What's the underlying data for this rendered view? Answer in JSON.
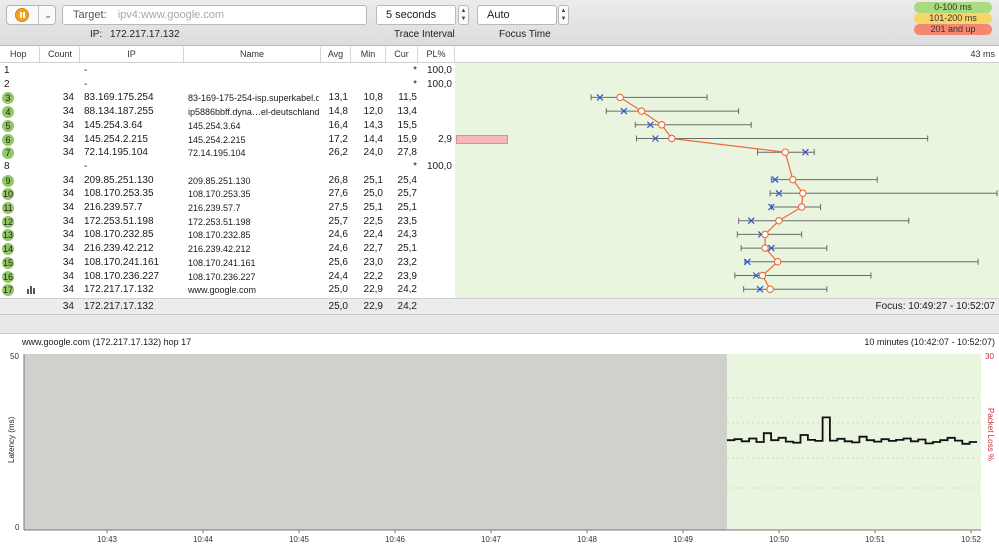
{
  "toolbar": {
    "menu_arrow": "⌄",
    "target_label": "Target:",
    "target_placeholder": "ipv4:www.google.com",
    "ip_label": "IP:",
    "ip_value": "172.217.17.132",
    "interval_value": "5 seconds",
    "interval_label": "Trace Interval",
    "focus_value": "Auto",
    "focus_label": "Focus Time",
    "legend": [
      {
        "label": "0-100 ms",
        "color": "#a9db7e"
      },
      {
        "label": "101-200 ms",
        "color": "#f6d56a"
      },
      {
        "label": "201 and up",
        "color": "#f48772"
      }
    ]
  },
  "table": {
    "headers": {
      "hop": "Hop",
      "count": "Count",
      "ip": "IP",
      "name": "Name",
      "avg": "Avg",
      "min": "Min",
      "cur": "Cur",
      "pl": "PL%"
    },
    "scale_label": "43 ms",
    "rows": [
      {
        "hop": "1",
        "count": "",
        "ip": "-",
        "name": "",
        "avg": "",
        "min": "",
        "cur": "*",
        "pl": "100,0",
        "badge": false
      },
      {
        "hop": "2",
        "count": "",
        "ip": "-",
        "name": "",
        "avg": "",
        "min": "",
        "cur": "*",
        "pl": "100,0",
        "badge": false
      },
      {
        "hop": "3",
        "count": "34",
        "ip": "83.169.175.254",
        "name": "83-169-175-254-isp.superkabel.de",
        "avg": "13,1",
        "min": "10,8",
        "cur": "11,5",
        "pl": "",
        "badge": true
      },
      {
        "hop": "4",
        "count": "34",
        "ip": "88.134.187.255",
        "name": "ip5886bbff.dyna…el-deutschland.de",
        "avg": "14,8",
        "min": "12,0",
        "cur": "13,4",
        "pl": "",
        "badge": true
      },
      {
        "hop": "5",
        "count": "34",
        "ip": "145.254.3.64",
        "name": "145.254.3.64",
        "avg": "16,4",
        "min": "14,3",
        "cur": "15,5",
        "pl": "",
        "badge": true
      },
      {
        "hop": "6",
        "count": "34",
        "ip": "145.254.2.215",
        "name": "145.254.2.215",
        "avg": "17,2",
        "min": "14,4",
        "cur": "15,9",
        "pl": "2,9",
        "badge": true
      },
      {
        "hop": "7",
        "count": "34",
        "ip": "72.14.195.104",
        "name": "72.14.195.104",
        "avg": "26,2",
        "min": "24,0",
        "cur": "27,8",
        "pl": "",
        "badge": true
      },
      {
        "hop": "8",
        "count": "",
        "ip": "-",
        "name": "",
        "avg": "",
        "min": "",
        "cur": "*",
        "pl": "100,0",
        "badge": false
      },
      {
        "hop": "9",
        "count": "34",
        "ip": "209.85.251.130",
        "name": "209.85.251.130",
        "avg": "26,8",
        "min": "25,1",
        "cur": "25,4",
        "pl": "",
        "badge": true
      },
      {
        "hop": "10",
        "count": "34",
        "ip": "108.170.253.35",
        "name": "108.170.253.35",
        "avg": "27,6",
        "min": "25,0",
        "cur": "25,7",
        "pl": "",
        "badge": true
      },
      {
        "hop": "11",
        "count": "34",
        "ip": "216.239.57.7",
        "name": "216.239.57.7",
        "avg": "27,5",
        "min": "25,1",
        "cur": "25,1",
        "pl": "",
        "badge": true
      },
      {
        "hop": "12",
        "count": "34",
        "ip": "172.253.51.198",
        "name": "172.253.51.198",
        "avg": "25,7",
        "min": "22,5",
        "cur": "23,5",
        "pl": "",
        "badge": true
      },
      {
        "hop": "13",
        "count": "34",
        "ip": "108.170.232.85",
        "name": "108.170.232.85",
        "avg": "24,6",
        "min": "22,4",
        "cur": "24,3",
        "pl": "",
        "badge": true
      },
      {
        "hop": "14",
        "count": "34",
        "ip": "216.239.42.212",
        "name": "216.239.42.212",
        "avg": "24,6",
        "min": "22,7",
        "cur": "25,1",
        "pl": "",
        "badge": true
      },
      {
        "hop": "15",
        "count": "34",
        "ip": "108.170.241.161",
        "name": "108.170.241.161",
        "avg": "25,6",
        "min": "23,0",
        "cur": "23,2",
        "pl": "",
        "badge": true
      },
      {
        "hop": "16",
        "count": "34",
        "ip": "108.170.236.227",
        "name": "108.170.236.227",
        "avg": "24,4",
        "min": "22,2",
        "cur": "23,9",
        "pl": "",
        "badge": true
      },
      {
        "hop": "17",
        "count": "34",
        "ip": "172.217.17.132",
        "name": "www.google.com",
        "avg": "25,0",
        "min": "22,9",
        "cur": "24,2",
        "pl": "",
        "badge": true
      }
    ],
    "summary": {
      "count": "34",
      "ip": "172.217.17.132",
      "avg": "25,0",
      "min": "22,9",
      "cur": "24,2"
    },
    "focus_text": "Focus: 10:49:27 - 10:52:07"
  },
  "chart_data": [
    {
      "type": "scatter",
      "x_unit": "ms",
      "x_max": 43,
      "hops": [
        3,
        4,
        5,
        6,
        7,
        9,
        10,
        11,
        12,
        13,
        14,
        15,
        16,
        17
      ],
      "avg": [
        13.1,
        14.8,
        16.4,
        17.2,
        26.2,
        26.8,
        27.6,
        27.5,
        25.7,
        24.6,
        24.6,
        25.6,
        24.4,
        25.0
      ],
      "min": [
        10.8,
        12.0,
        14.3,
        14.4,
        24.0,
        25.1,
        25.0,
        25.1,
        22.5,
        22.4,
        22.7,
        23.0,
        22.2,
        22.9
      ],
      "cur": [
        11.5,
        13.4,
        15.5,
        15.9,
        27.8,
        25.4,
        25.7,
        25.1,
        23.5,
        24.3,
        25.1,
        23.2,
        23.9,
        24.2
      ],
      "max": [
        20.0,
        22.5,
        23.5,
        37.5,
        28.5,
        33.5,
        43.0,
        29.0,
        36.0,
        27.5,
        29.5,
        41.5,
        33.0,
        29.5
      ],
      "packet_loss_hop": 6,
      "packet_loss_pct": 2.9
    },
    {
      "type": "line",
      "title": "www.google.com (172.217.17.132) hop 17",
      "range_label": "10 minutes (10:42:07 - 10:52:07)",
      "ylabel": "Latency (ms)",
      "y2label": "Packet Loss %",
      "ylim": [
        0,
        50
      ],
      "y_ticks_left": [
        "50",
        "0"
      ],
      "y_ticks_right": [
        "30"
      ],
      "x_ticks": [
        "10:43",
        "10:44",
        "10:45",
        "10:46",
        "10:47",
        "10:48",
        "10:49",
        "10:50",
        "10:51",
        "10:52"
      ],
      "focus_start": "10:49:27",
      "latency": [
        25.5,
        25.8,
        25.2,
        26.0,
        25.0,
        27.5,
        25.5,
        26.2,
        25.1,
        24.8,
        27.0,
        25.6,
        25.3,
        32.0,
        25.4,
        25.9,
        25.2,
        24.9,
        26.5,
        25.5,
        25.1,
        25.8,
        25.3,
        25.6,
        26.0,
        25.2,
        25.7,
        24.6,
        25.0,
        25.5,
        26.2,
        25.4,
        24.5,
        25.0
      ]
    }
  ]
}
